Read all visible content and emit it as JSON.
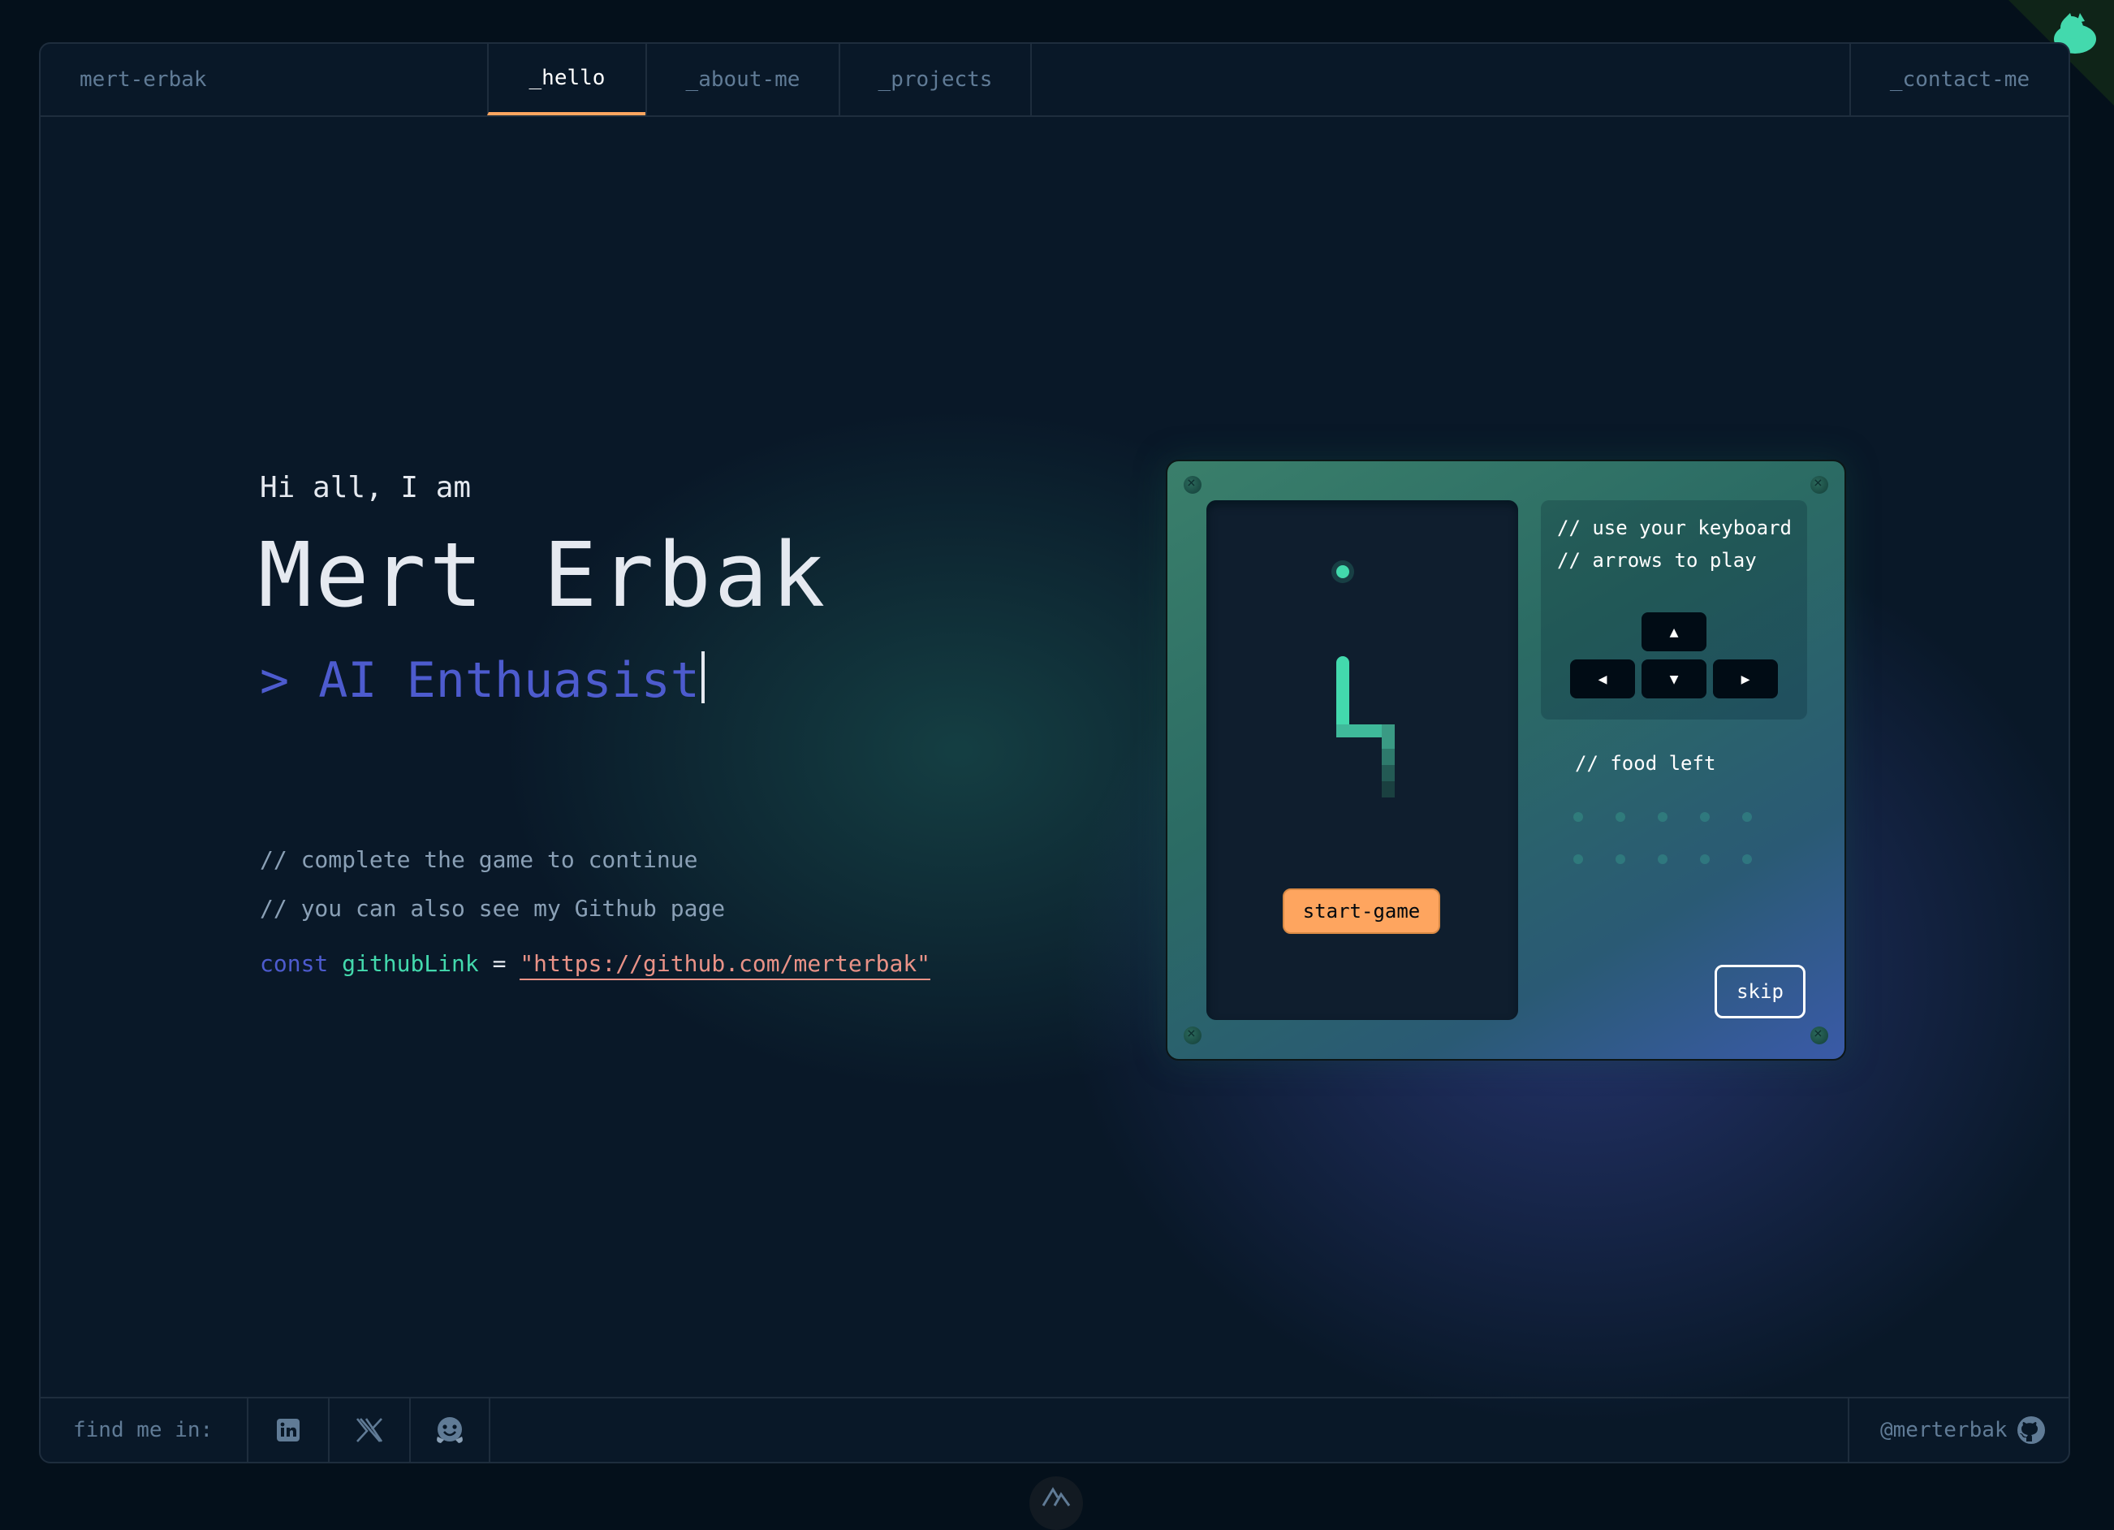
{
  "header": {
    "brand": "mert-erbak",
    "tabs": [
      {
        "label": "_hello"
      },
      {
        "label": "_about-me"
      },
      {
        "label": "_projects"
      }
    ],
    "contact": "_contact-me"
  },
  "hero": {
    "greeting": "Hi all, I am",
    "name": "Mert Erbak",
    "role": "> AI Enthuasist",
    "comment1": "// complete the game to continue",
    "comment2": "// you can also see my Github page",
    "code": {
      "keyword": "const",
      "variable": "githubLink",
      "operator": "=",
      "value": "\"https://github.com/merterbak\""
    }
  },
  "game": {
    "start_label": "start-game",
    "controls_comment_1": "// use your keyboard",
    "controls_comment_2": "// arrows to play",
    "food_label": "// food left",
    "skip_label": "skip",
    "keys": [
      "arrow-up-icon",
      "arrow-left-icon",
      "arrow-down-icon",
      "arrow-right-icon"
    ]
  },
  "footer": {
    "findme": "find me in:",
    "socials": [
      "linkedin-icon",
      "x-icon",
      "huggingface-icon"
    ],
    "handle": "@merterbak",
    "handle_icon": "github-icon"
  },
  "colors": {
    "accent_orange": "#fea55f",
    "accent_green": "#43d9ad",
    "accent_purple": "#4d5bce",
    "string_pink": "#e99287",
    "border": "#1e2d3d"
  }
}
